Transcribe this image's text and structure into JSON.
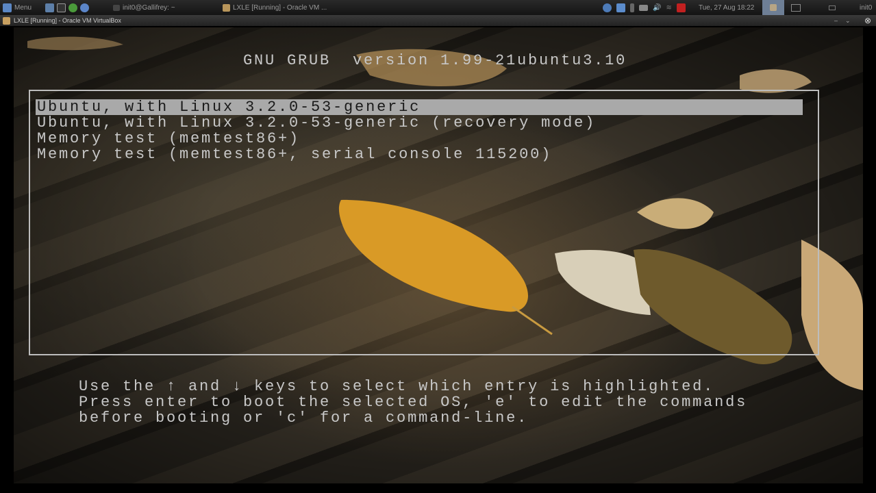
{
  "taskbar": {
    "menu_label": "Menu",
    "tasks": [
      "init0@Gallifrey: ~",
      "LXLE [Running] - Oracle VM ..."
    ],
    "clock": "Tue, 27 Aug  18:22",
    "user": "init0"
  },
  "window": {
    "title": "LXLE [Running] - Oracle VM VirtualBox"
  },
  "grub": {
    "title": "GNU GRUB  version 1.99-21ubuntu3.10",
    "entries": [
      "Ubuntu, with Linux 3.2.0-53-generic",
      "Ubuntu, with Linux 3.2.0-53-generic (recovery mode)",
      "Memory test (memtest86+)",
      "Memory test (memtest86+, serial console 115200)"
    ],
    "selected_index": 0,
    "help": [
      "Use the ↑ and ↓ keys to select which entry is highlighted.",
      "Press enter to boot the selected OS, 'e' to edit the commands",
      "before booting or 'c' for a command-line."
    ]
  }
}
